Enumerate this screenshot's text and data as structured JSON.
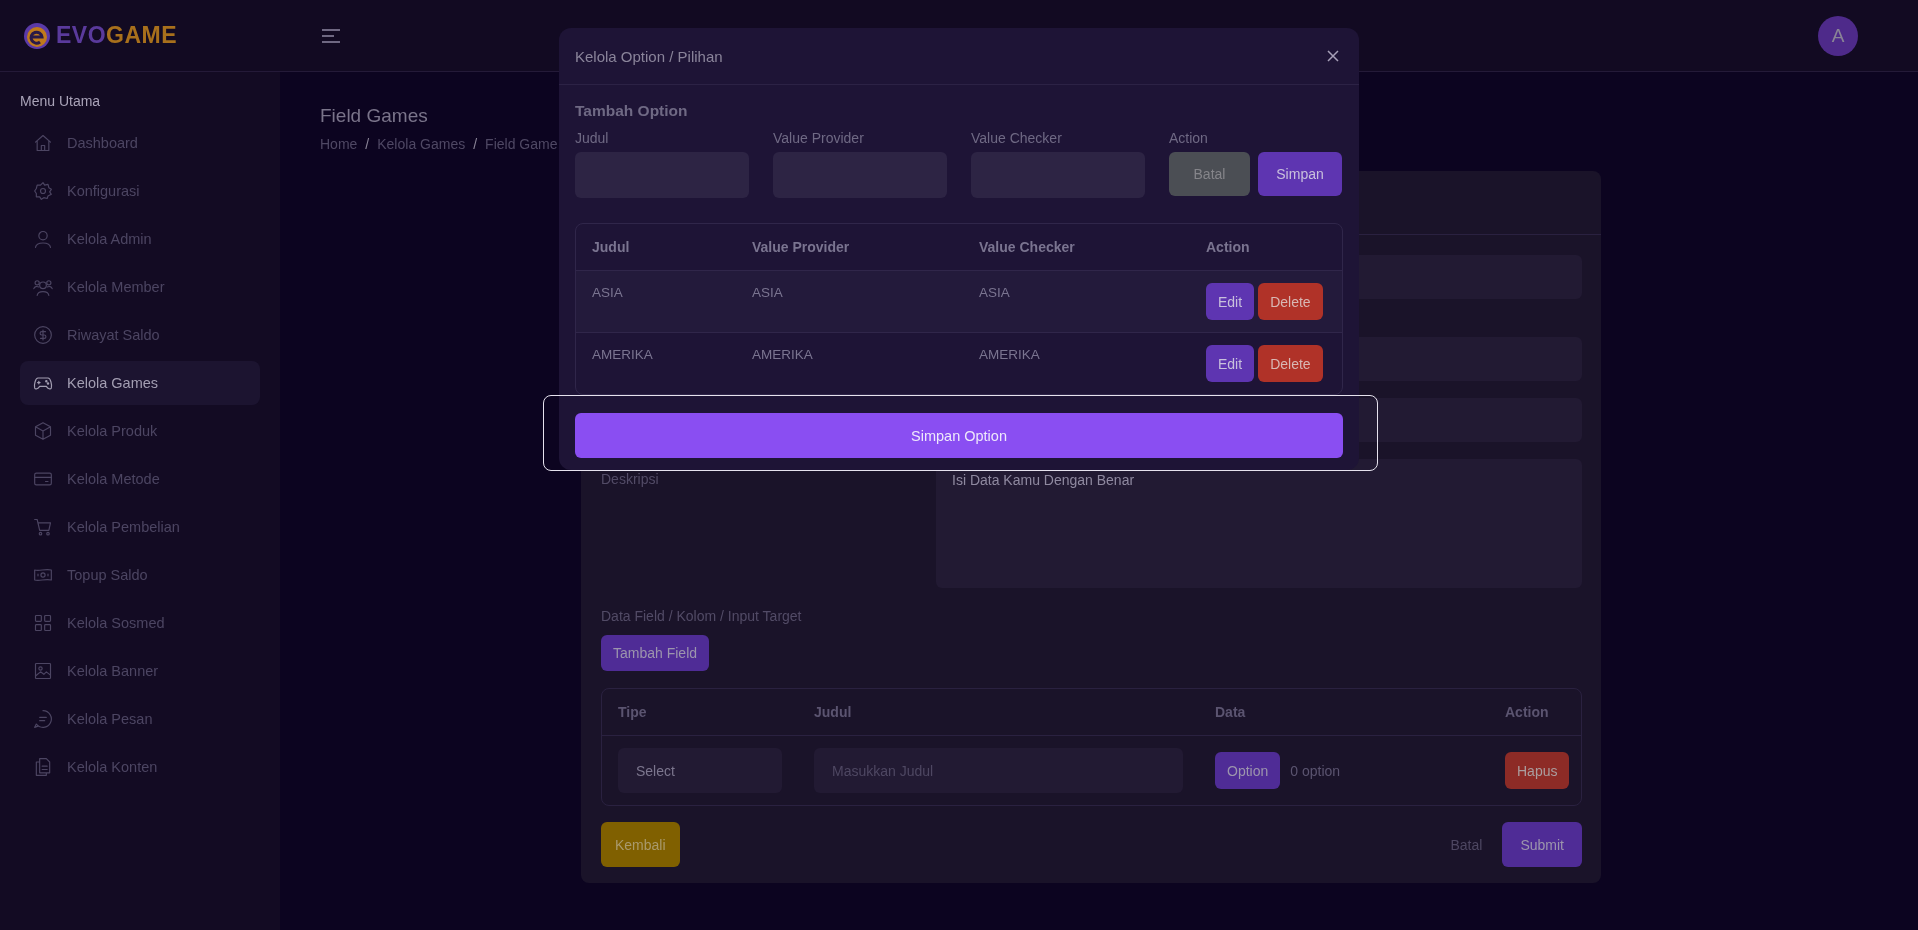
{
  "brand": {
    "part1": "EVO",
    "part2": "GAME"
  },
  "header": {
    "avatar": "A"
  },
  "sidebar": {
    "heading": "Menu Utama",
    "items": [
      {
        "label": "Dashboard",
        "kind": "home",
        "selected": false
      },
      {
        "label": "Konfigurasi",
        "kind": "gear",
        "selected": false
      },
      {
        "label": "Kelola Admin",
        "kind": "user",
        "selected": false
      },
      {
        "label": "Kelola Member",
        "kind": "users",
        "selected": false
      },
      {
        "label": "Riwayat Saldo",
        "kind": "coin",
        "selected": false
      },
      {
        "label": "Kelola Games",
        "kind": "gamepad",
        "selected": true
      },
      {
        "label": "Kelola Produk",
        "kind": "box",
        "selected": false
      },
      {
        "label": "Kelola Metode",
        "kind": "card",
        "selected": false
      },
      {
        "label": "Kelola Pembelian",
        "kind": "cart",
        "selected": false
      },
      {
        "label": "Topup Saldo",
        "kind": "money",
        "selected": false
      },
      {
        "label": "Kelola Sosmed",
        "kind": "grid",
        "selected": false
      },
      {
        "label": "Kelola Banner",
        "kind": "image",
        "selected": false
      },
      {
        "label": "Kelola Pesan",
        "kind": "chat",
        "selected": false
      },
      {
        "label": "Kelola Konten",
        "kind": "files",
        "selected": false
      }
    ]
  },
  "page": {
    "title": "Field Games",
    "breadcrumb": [
      "Home",
      "Kelola Games",
      "Field Game"
    ],
    "breadcrumb_separator": "/"
  },
  "form": {
    "description_label": "Deskripsi",
    "description_value": "Isi Data Kamu Dengan Benar",
    "fields_label": "Data Field / Kolom / Input Target",
    "add_field_button": "Tambah Field",
    "fields_table": {
      "columns": [
        "Tipe",
        "Judul",
        "Data",
        "Action"
      ],
      "rows": [
        {
          "type": "Select",
          "title_placeholder": "Masukkan Judul",
          "option_button": "Option",
          "option_count": "0 option",
          "delete_button": "Hapus"
        }
      ]
    },
    "back_button": "Kembali",
    "cancel_button": "Batal",
    "submit_button": "Submit"
  },
  "modal": {
    "title": "Kelola Option / Pilihan",
    "section": "Tambah Option",
    "labels": [
      "Judul",
      "Value Provider",
      "Value Checker",
      "Action"
    ],
    "cancel_button": "Batal",
    "save_button": "Simpan",
    "table": {
      "columns": [
        "Judul",
        "Value Provider",
        "Value Checker",
        "Action"
      ],
      "rows": [
        {
          "title": "ASIA",
          "provider": "ASIA",
          "checker": "ASIA",
          "edit": "Edit",
          "delete": "Delete"
        },
        {
          "title": "AMERIKA",
          "provider": "AMERIKA",
          "checker": "AMERIKA",
          "edit": "Edit",
          "delete": "Delete"
        }
      ]
    },
    "submit_button": "Simpan Option",
    "highlighted": true
  }
}
